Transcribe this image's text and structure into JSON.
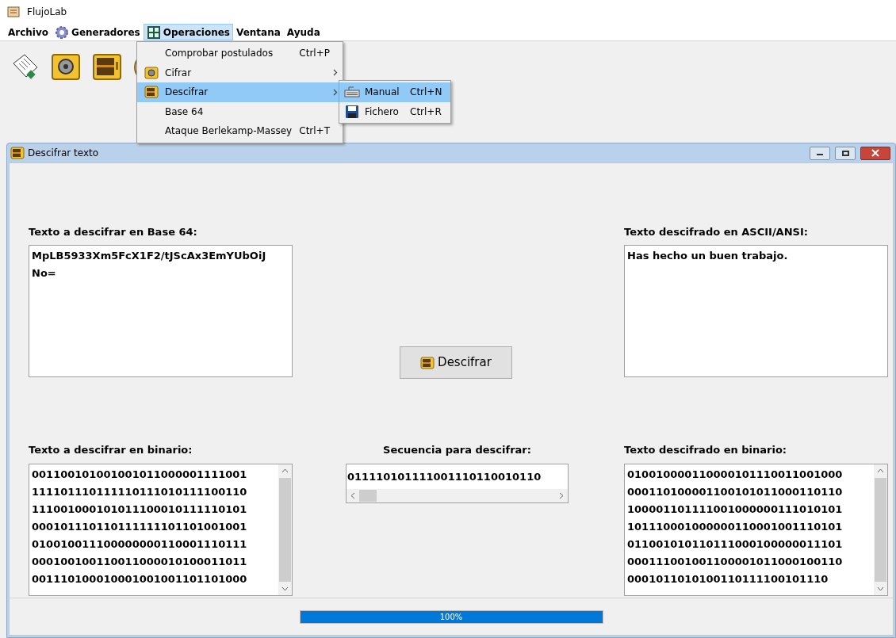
{
  "app_title": "FlujoLab",
  "menu_bar": [
    {
      "label": "Archivo",
      "kind": "plain",
      "selected": false
    },
    {
      "label": "Generadores",
      "kind": "gear",
      "selected": false
    },
    {
      "label": "Operaciones",
      "kind": "calc",
      "selected": true
    },
    {
      "label": "Ventana",
      "kind": "plain",
      "selected": false
    },
    {
      "label": "Ayuda",
      "kind": "plain",
      "selected": false
    }
  ],
  "dropdown": [
    {
      "label": "Comprobar postulados",
      "shortcut": "Ctrl+P",
      "kind": "plain",
      "submenu": false,
      "selected": false
    },
    {
      "label": "Cifrar",
      "kind": "safe",
      "submenu": true,
      "selected": false
    },
    {
      "label": "Descifrar",
      "kind": "opensafe",
      "submenu": true,
      "selected": true
    },
    {
      "label": "Base 64",
      "kind": "plain",
      "submenu": false,
      "selected": false
    },
    {
      "label": "Ataque Berlekamp-Massey",
      "shortcut": "Ctrl+T",
      "kind": "plain",
      "submenu": false,
      "selected": false
    }
  ],
  "submenu": [
    {
      "label": "Manual",
      "shortcut": "Ctrl+N",
      "kind": "keyboard",
      "selected": true
    },
    {
      "label": "Fichero",
      "shortcut": "Ctrl+R",
      "kind": "floppy",
      "selected": false
    }
  ],
  "window": {
    "title": "Descifrar texto"
  },
  "input_base64": {
    "label": "Texto a descifrar en Base 64:",
    "lines": [
      "MpLB5933Xm5FcX1F2/tJScAx3EmYUbOiJ",
      "No="
    ]
  },
  "output_ascii": {
    "label": "Texto descifrado en ASCII/ANSI:",
    "lines": [
      "Has hecho un buen trabajo."
    ]
  },
  "decrypt_button": "Descifrar",
  "input_binary": {
    "label": "Texto a descifrar en binario:",
    "lines": [
      "001100101001001011000001111001",
      "111101110111110111010111100110",
      "111001000101011100010111110101",
      "000101110110111111101101001001",
      "010010011100000000110001110111",
      "000100100110011000010100011011",
      "001110100010001001001101101000"
    ]
  },
  "sequence": {
    "label": "Secuencia para descifrar:",
    "value": "011110101111001110110010110"
  },
  "output_binary": {
    "label": "Texto descifrado en binario:",
    "lines": [
      "010010000110000101110011001000",
      "000110100001100101011000110110",
      "100001101111001000000111010101",
      "101110001000000110001001110101",
      "011001010110111000100000011101",
      "000111001001100001011000100110",
      "0001011010100110111100101110"
    ]
  },
  "progress": {
    "level": 1,
    "label": "100%"
  }
}
